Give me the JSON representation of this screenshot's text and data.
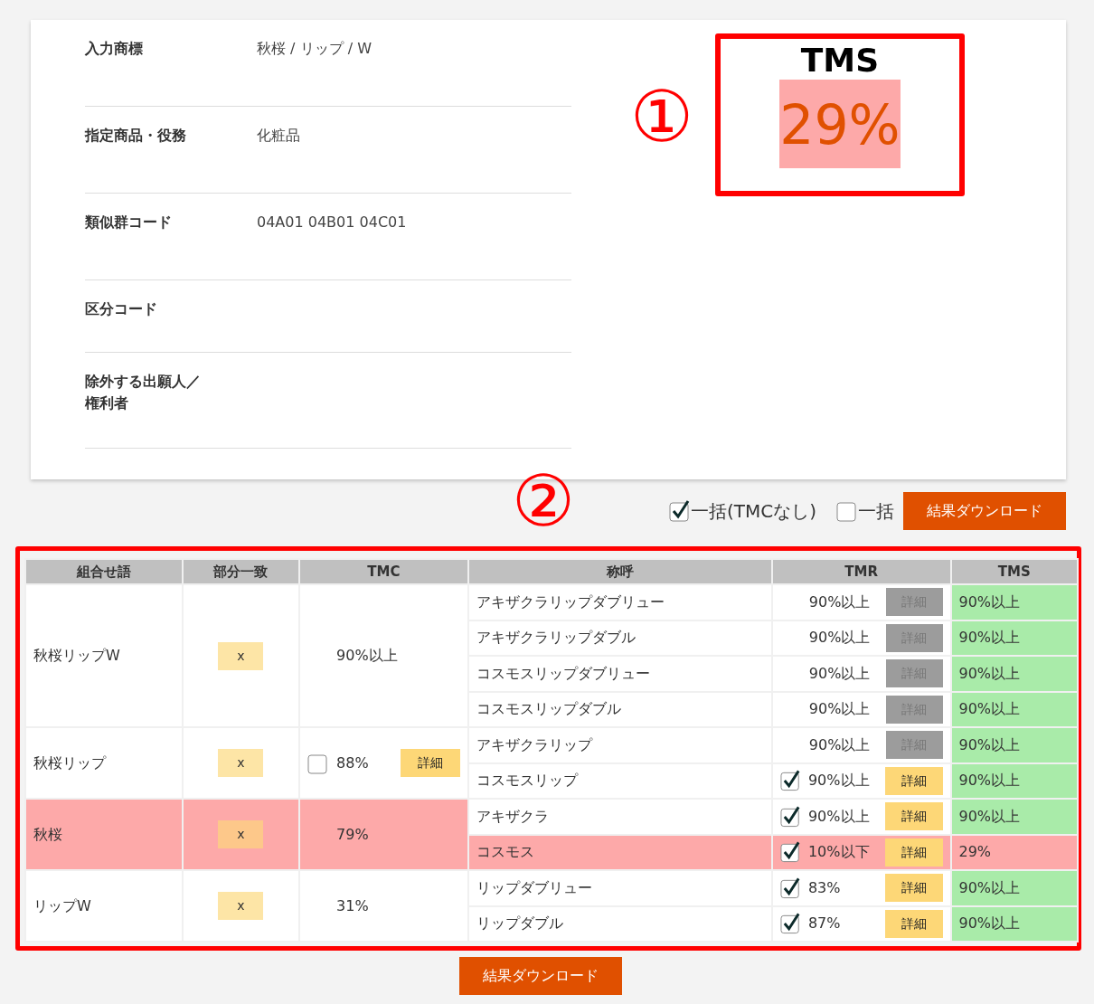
{
  "info_rows": [
    {
      "label": "入力商標",
      "value": "秋桜 / リップ / W"
    },
    {
      "label": "指定商品・役務",
      "value": "化粧品"
    },
    {
      "label": "類似群コード",
      "value": "04A01 04B01 04C01"
    },
    {
      "label": "区分コード"
    },
    {
      "label": "除外する出願人／権利者"
    }
  ],
  "tms_summary": {
    "title": "TMS",
    "value": "29%",
    "flagged": true
  },
  "annotations": [
    "①",
    "②"
  ],
  "bulk_options": [
    {
      "label": "一括(TMCなし)",
      "checked": true
    },
    {
      "label": "一括",
      "checked": false
    }
  ],
  "toolbar_download_button": "結果ダウンロード",
  "bottom_download_button": "結果ダウンロード",
  "table": {
    "columns": [
      "組合せ語",
      "部分一致",
      "TMC",
      "称呼",
      "TMR",
      "TMS"
    ],
    "groups": [
      {
        "word": "秋桜リップW",
        "partial": "x",
        "flagged": false,
        "tmc": {
          "value": "90%以上"
        },
        "readings": [
          {
            "text": "アキザクラリップダブリュー",
            "flagged": false,
            "tmr": {
              "value": "90%以上",
              "detail": {
                "label": "詳細",
                "disabled": true
              }
            },
            "tms": {
              "value": "90%以上",
              "flagged": false
            }
          },
          {
            "text": "アキザクラリップダブル",
            "flagged": false,
            "tmr": {
              "value": "90%以上",
              "detail": {
                "label": "詳細",
                "disabled": true
              }
            },
            "tms": {
              "value": "90%以上",
              "flagged": false
            }
          },
          {
            "text": "コスモスリップダブリュー",
            "flagged": false,
            "tmr": {
              "value": "90%以上",
              "detail": {
                "label": "詳細",
                "disabled": true
              }
            },
            "tms": {
              "value": "90%以上",
              "flagged": false
            }
          },
          {
            "text": "コスモスリップダブル",
            "flagged": false,
            "tmr": {
              "value": "90%以上",
              "detail": {
                "label": "詳細",
                "disabled": true
              }
            },
            "tms": {
              "value": "90%以上",
              "flagged": false
            }
          }
        ]
      },
      {
        "word": "秋桜リップ",
        "partial": "x",
        "flagged": false,
        "tmc": {
          "value": "88%",
          "checked": false,
          "detail": {
            "label": "詳細",
            "disabled": false
          }
        },
        "readings": [
          {
            "text": "アキザクラリップ",
            "flagged": false,
            "tmr": {
              "value": "90%以上",
              "detail": {
                "label": "詳細",
                "disabled": true
              }
            },
            "tms": {
              "value": "90%以上",
              "flagged": false
            }
          },
          {
            "text": "コスモスリップ",
            "flagged": false,
            "tmr": {
              "value": "90%以上",
              "checked": true,
              "detail": {
                "label": "詳細",
                "disabled": false
              }
            },
            "tms": {
              "value": "90%以上",
              "flagged": false
            }
          }
        ]
      },
      {
        "word": "秋桜",
        "partial": "x",
        "flagged": true,
        "tmc": {
          "value": "79%"
        },
        "readings": [
          {
            "text": "アキザクラ",
            "flagged": false,
            "tmr": {
              "value": "90%以上",
              "checked": true,
              "detail": {
                "label": "詳細",
                "disabled": false
              }
            },
            "tms": {
              "value": "90%以上",
              "flagged": false
            }
          },
          {
            "text": "コスモス",
            "flagged": true,
            "tmr": {
              "value": "10%以下",
              "checked": true,
              "detail": {
                "label": "詳細",
                "disabled": false
              }
            },
            "tms": {
              "value": "29%",
              "flagged": true
            }
          }
        ]
      },
      {
        "word": "リップW",
        "partial": "x",
        "flagged": false,
        "tmc": {
          "value": "31%"
        },
        "readings": [
          {
            "text": "リップダブリュー",
            "flagged": false,
            "tmr": {
              "value": "83%",
              "checked": true,
              "detail": {
                "label": "詳細",
                "disabled": false
              }
            },
            "tms": {
              "value": "90%以上",
              "flagged": false
            }
          },
          {
            "text": "リップダブル",
            "flagged": false,
            "tmr": {
              "value": "87%",
              "checked": true,
              "detail": {
                "label": "詳細",
                "disabled": false
              }
            },
            "tms": {
              "value": "90%以上",
              "flagged": false
            }
          }
        ]
      }
    ]
  }
}
